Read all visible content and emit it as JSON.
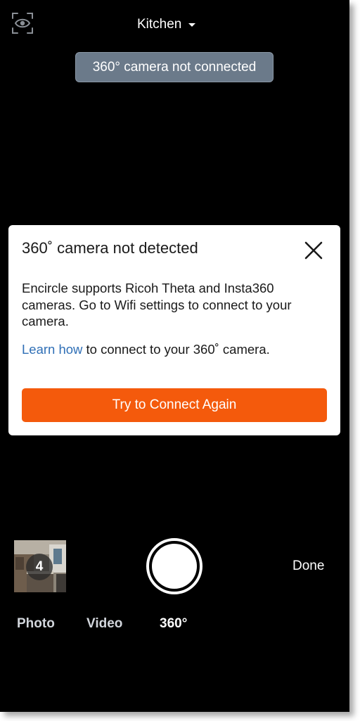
{
  "top_bar": {
    "eye_icon": "eye-in-frame-icon",
    "room_label": "Kitchen",
    "room_dropdown_icon": "caret-down-icon"
  },
  "status": {
    "text": "360° camera not connected"
  },
  "dialog": {
    "title": "360˚ camera not detected",
    "close_icon": "close-icon",
    "body": "Encircle supports Ricoh Theta and Insta360 cameras. Go to Wifi settings to connect to your camera.",
    "learn_link": "Learn how",
    "learn_rest": " to connect to your 360˚ camera.",
    "button_label": "Try to Connect Again",
    "accent_color": "#f45a0c",
    "link_color": "#2f6fb6"
  },
  "capture_bar": {
    "thumbnail_count": "4",
    "shutter_icon": "shutter-icon",
    "done_label": "Done"
  },
  "modes": {
    "photo": "Photo",
    "video": "Video",
    "pano": "360°",
    "selected": "360°"
  }
}
